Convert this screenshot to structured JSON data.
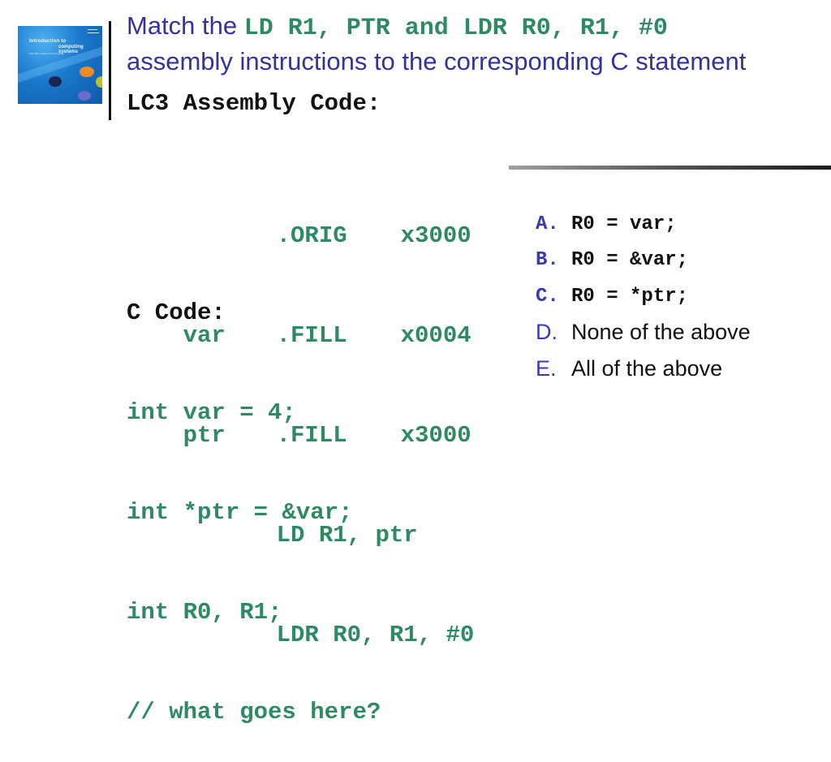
{
  "slide": {
    "title": {
      "prefix": "Match the ",
      "code": "LD R1, PTR and LDR R0, R1, #0",
      "suffix": "assembly instructions to the corresponding C statement"
    },
    "book_cover": {
      "line1": "Introduction to",
      "line2": "computing systems",
      "line3": "from bits & gates to C & beyond"
    },
    "assembly": {
      "heading": "LC3 Assembly Code:",
      "rows": [
        {
          "label": "",
          "op": ".ORIG",
          "arg": "x3000"
        },
        {
          "label": "var",
          "op": ".FILL",
          "arg": "x0004"
        },
        {
          "label": "ptr",
          "op": ".FILL",
          "arg": "x3000"
        },
        {
          "label": "",
          "op": "LD R1, ptr",
          "arg": ""
        },
        {
          "label": "",
          "op": "LDR R0, R1, #0",
          "arg": ""
        }
      ]
    },
    "c_code": {
      "heading": "C Code:",
      "lines": [
        "int var = 4;",
        "int *ptr = &var;",
        "int R0, R1;",
        "// what goes here?"
      ]
    },
    "options": [
      {
        "letter": "A.",
        "text": "R0 = var;",
        "style": "code"
      },
      {
        "letter": "B.",
        "text": "R0 = &var;",
        "style": "code"
      },
      {
        "letter": "C.",
        "text": "R0 = *ptr;",
        "style": "code"
      },
      {
        "letter": "D.",
        "text": "None of the above",
        "style": "text"
      },
      {
        "letter": "E.",
        "text": "All of the above",
        "style": "text"
      }
    ],
    "colors": {
      "title": "#33339a",
      "code_green": "#2e8a62",
      "option_letter": "#3a3ab0",
      "text": "#111111"
    }
  }
}
